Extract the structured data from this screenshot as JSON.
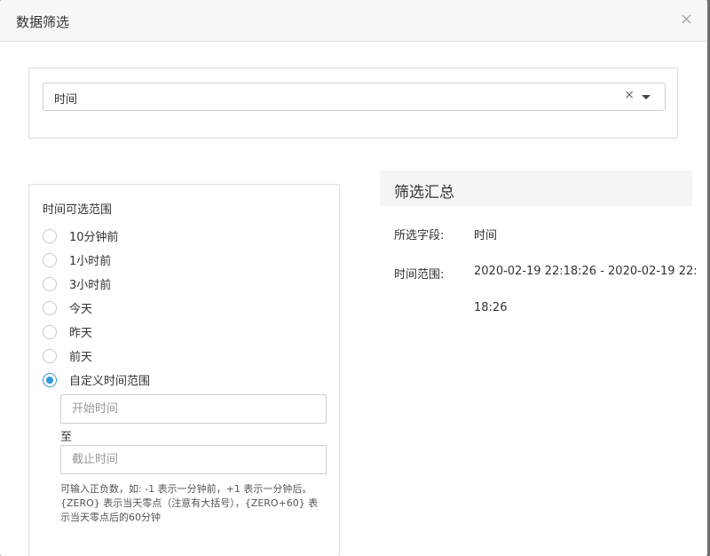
{
  "modal": {
    "title": "数据筛选",
    "close_label": "×"
  },
  "field_select": {
    "value": "时间",
    "clear_label": "×"
  },
  "time_range": {
    "title": "时间可选范围",
    "options": [
      {
        "label": "10分钟前",
        "checked": false
      },
      {
        "label": "1小时前",
        "checked": false
      },
      {
        "label": "3小时前",
        "checked": false
      },
      {
        "label": "今天",
        "checked": false
      },
      {
        "label": "昨天",
        "checked": false
      },
      {
        "label": "前天",
        "checked": false
      },
      {
        "label": "自定义时间范围",
        "checked": true
      }
    ],
    "start_placeholder": "开始时间",
    "to_label": "至",
    "end_placeholder": "截止时间",
    "hint_line1": "可输入正负数，如: -1 表示一分钟前，+1 表示一分钟后。",
    "hint_line2": "{ZERO} 表示当天零点（注意有大括号），{ZERO+60} 表",
    "hint_line3": "示当天零点后的60分钟"
  },
  "summary": {
    "title": "筛选汇总",
    "field_label": "所选字段:",
    "field_value": "时间",
    "range_label": "时间范围:",
    "range_value_line1": "2020-02-19 22:18:26 - 2020-02-19 22:",
    "range_value_line2": "18:26"
  },
  "colors": {
    "accent": "#2f9ad7",
    "overlay": "#6f6f6f"
  }
}
